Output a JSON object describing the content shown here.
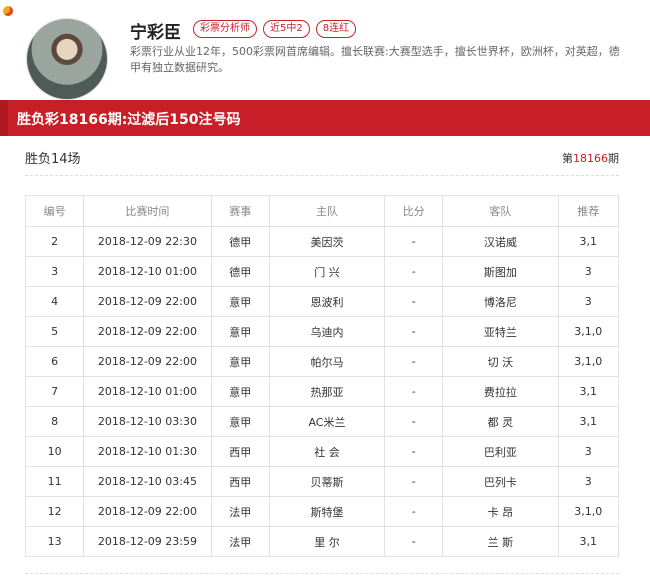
{
  "author": {
    "name": "宁彩臣",
    "badges": [
      "彩票分析师",
      "近5中2",
      "8连红"
    ],
    "bio": "彩票行业从业12年，500彩票网首席编辑。擅长联赛:大赛型选手，擅长世界杯，欧洲杯，对英超，德甲有独立数据研究。"
  },
  "header": {
    "title": "胜负彩18166期:过滤后150注号码"
  },
  "subbar": {
    "left": "胜负14场",
    "issue_prefix": "第",
    "issue_number": "18166",
    "issue_suffix": "期"
  },
  "table": {
    "columns": [
      "编号",
      "比赛时间",
      "赛事",
      "主队",
      "比分",
      "客队",
      "推荐"
    ],
    "rows": [
      {
        "no": "2",
        "time": "2018-12-09 22:30",
        "league": "德甲",
        "home": "美因茨",
        "score": "-",
        "away": "汉诺威",
        "pick": "3,1"
      },
      {
        "no": "3",
        "time": "2018-12-10 01:00",
        "league": "德甲",
        "home": "门 兴",
        "score": "-",
        "away": "斯图加",
        "pick": "3"
      },
      {
        "no": "4",
        "time": "2018-12-09 22:00",
        "league": "意甲",
        "home": "恩波利",
        "score": "-",
        "away": "博洛尼",
        "pick": "3"
      },
      {
        "no": "5",
        "time": "2018-12-09 22:00",
        "league": "意甲",
        "home": "乌迪内",
        "score": "-",
        "away": "亚特兰",
        "pick": "3,1,0"
      },
      {
        "no": "6",
        "time": "2018-12-09 22:00",
        "league": "意甲",
        "home": "帕尔马",
        "score": "-",
        "away": "切 沃",
        "pick": "3,1,0"
      },
      {
        "no": "7",
        "time": "2018-12-10 01:00",
        "league": "意甲",
        "home": "热那亚",
        "score": "-",
        "away": "费拉拉",
        "pick": "3,1"
      },
      {
        "no": "8",
        "time": "2018-12-10 03:30",
        "league": "意甲",
        "home": "AC米兰",
        "score": "-",
        "away": "都 灵",
        "pick": "3,1"
      },
      {
        "no": "10",
        "time": "2018-12-10 01:30",
        "league": "西甲",
        "home": "社 会",
        "score": "-",
        "away": "巴利亚",
        "pick": "3"
      },
      {
        "no": "11",
        "time": "2018-12-10 03:45",
        "league": "西甲",
        "home": "贝蒂斯",
        "score": "-",
        "away": "巴列卡",
        "pick": "3"
      },
      {
        "no": "12",
        "time": "2018-12-09 22:00",
        "league": "法甲",
        "home": "斯特堡",
        "score": "-",
        "away": "卡 昂",
        "pick": "3,1,0"
      },
      {
        "no": "13",
        "time": "2018-12-09 23:59",
        "league": "法甲",
        "home": "里 尔",
        "score": "-",
        "away": "兰 斯",
        "pick": "3,1"
      }
    ]
  }
}
